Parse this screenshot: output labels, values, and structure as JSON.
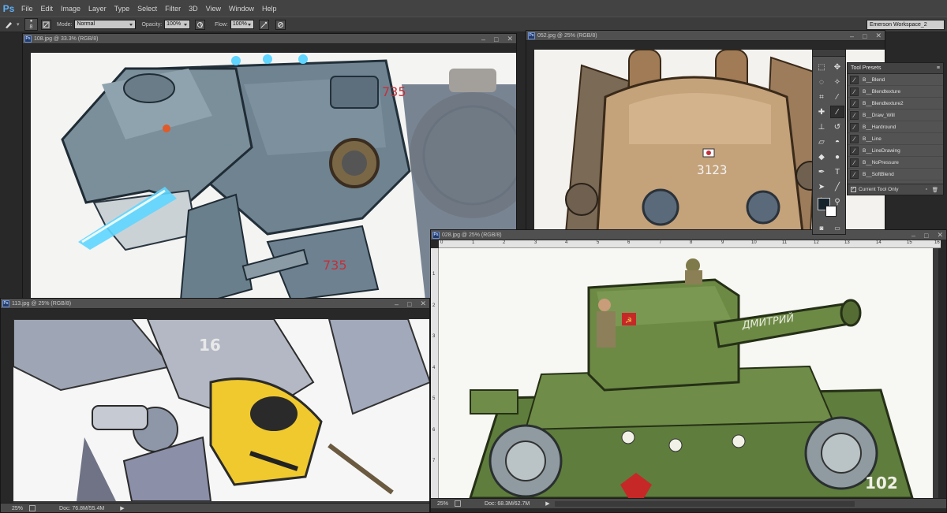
{
  "app": {
    "logo": "Ps"
  },
  "menu": [
    "File",
    "Edit",
    "Image",
    "Layer",
    "Type",
    "Select",
    "Filter",
    "3D",
    "View",
    "Window",
    "Help"
  ],
  "options": {
    "brush_size": "8",
    "mode_label": "Mode:",
    "mode_value": "Normal",
    "opacity_label": "Opacity:",
    "opacity_value": "100%",
    "flow_label": "Flow:",
    "flow_value": "100%",
    "workspace": "Emerson Workspace_2"
  },
  "documents": {
    "doc108": {
      "title": "108.jpg @ 33.3% (RGB/8)",
      "decal": "735"
    },
    "doc052": {
      "title": "052.jpg @ 25% (RGB/8)",
      "decal": "3123"
    },
    "doc113": {
      "title": "113.jpg @ 25% (RGB/8)",
      "zoom": "25%",
      "doc_size": "Doc: 76.8M/55.4M",
      "decal": "16"
    },
    "doc028": {
      "title": "028.jpg @ 25% (RGB/8)",
      "zoom": "25%",
      "doc_size": "Doc: 68.3M/62.7M",
      "turret_text": "ДМИТРИЙ",
      "hull_text": "102",
      "ruler_h": [
        "0",
        "1",
        "2",
        "3",
        "4",
        "5",
        "6",
        "7",
        "8",
        "9",
        "10",
        "11",
        "12",
        "13",
        "14",
        "15",
        "16"
      ],
      "ruler_v": [
        "1",
        "2",
        "3",
        "4",
        "5",
        "6",
        "7"
      ]
    }
  },
  "tool_presets": {
    "tab_label": "Tool Presets",
    "items": [
      "B__Blend",
      "B__Blendtexture",
      "B__Blendtexture2",
      "B__Draw_Will",
      "B__Hardround",
      "B__Line",
      "B__LineDrawing",
      "B__NoPressure",
      "B__SoftBlend"
    ],
    "current_only_label": "Current Tool Only"
  },
  "colors": {
    "foreground": "#16242e",
    "background": "#ffffff",
    "ps_blue": "#5fb0f5"
  }
}
